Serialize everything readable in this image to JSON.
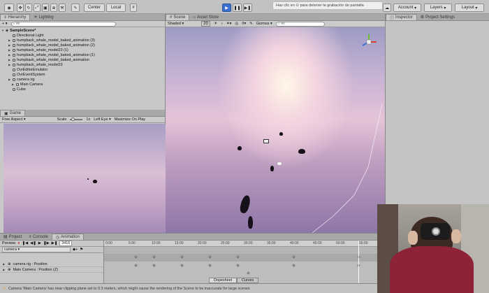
{
  "toolbar": {
    "tool_icons": [
      "hand-icon",
      "move-icon",
      "rotate-icon",
      "scale-icon",
      "rect-icon",
      "transform-icon",
      "custom-tool-icon"
    ],
    "center_label": "Center",
    "local_label": "Local",
    "notification": "Haz clic en ⊙ para detener la grabación de pantalla",
    "account_label": "Account",
    "layers_label": "Layers",
    "layout_label": "Layout"
  },
  "hierarchy": {
    "tabs": [
      {
        "label": "Hierarchy"
      },
      {
        "label": "Lighting"
      }
    ],
    "add_label": "+ ▾",
    "search_placeholder": "All",
    "scene_name": "SampleScene*",
    "items": [
      {
        "label": "Directional Light",
        "indent": 2,
        "caret": false
      },
      {
        "label": "humpback_whale_model_baked_animation (3)",
        "indent": 2,
        "caret": true
      },
      {
        "label": "humpback_whale_model_baked_animation (2)",
        "indent": 2,
        "caret": true
      },
      {
        "label": "humpback_whale_model23 (1)",
        "indent": 2,
        "caret": true
      },
      {
        "label": "humpback_whale_model_baked_animation (1)",
        "indent": 2,
        "caret": true
      },
      {
        "label": "humpback_whale_model_baked_animation",
        "indent": 2,
        "caret": true
      },
      {
        "label": "humpback_whale_model23",
        "indent": 2,
        "caret": true
      },
      {
        "label": "OvrEditorEmulator",
        "indent": 2,
        "caret": false
      },
      {
        "label": "OvrEventSystem",
        "indent": 2,
        "caret": false
      },
      {
        "label": "camera rig",
        "indent": 2,
        "caret": true
      },
      {
        "label": "Main Camera",
        "indent": 3,
        "caret": true
      },
      {
        "label": "Cube",
        "indent": 2,
        "caret": false
      }
    ]
  },
  "game": {
    "tab_label": "Game",
    "aspect": "Free Aspect",
    "scale_label": "Scale",
    "scale_value": "1x",
    "eye": "Left Eye",
    "maximize": "Maximize On Play"
  },
  "scene": {
    "tabs": [
      {
        "label": "Scene"
      },
      {
        "label": "Asset Store"
      }
    ],
    "shading": "Shaded",
    "mode_2d": "2D",
    "gizmos": "Gizmos",
    "search_placeholder": "All"
  },
  "inspector": {
    "tabs": [
      {
        "label": "Inspector"
      },
      {
        "label": "Project Settings"
      }
    ]
  },
  "animation": {
    "tabs": [
      {
        "label": "Project"
      },
      {
        "label": "Console"
      },
      {
        "label": "Animation"
      }
    ],
    "preview_label": "Preview",
    "frame": "3416",
    "clip": "camera",
    "ticks": [
      "0:00",
      "5:00",
      "10:00",
      "15:00",
      "20:00",
      "25:00",
      "30:00",
      "35:00",
      "40:00",
      "45:00",
      "50:00",
      "55:00"
    ],
    "tracks": [
      {
        "label": "camera rig : Position"
      },
      {
        "label": "Main Camera : Position (Z)"
      }
    ],
    "dopesheet_label": "Dopesheet",
    "curves_label": "Curves"
  },
  "status": {
    "message": "Camera 'Main Camera' has near clipping plane set to 0.3 meters, which might cause the rendering of the Scene to be inaccurate for large scenes"
  }
}
